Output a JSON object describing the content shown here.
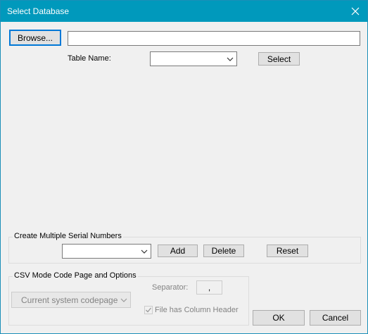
{
  "window": {
    "title": "Select Database"
  },
  "toolbar": {
    "browse_label": "Browse...",
    "path_value": "",
    "table_name_label": "Table Name:",
    "table_name_value": "",
    "select_label": "Select"
  },
  "serial_group": {
    "title": "Create Multiple Serial Numbers",
    "combo_value": "",
    "add_label": "Add",
    "delete_label": "Delete",
    "reset_label": "Reset"
  },
  "csv_group": {
    "title": "CSV Mode Code Page and Options",
    "codepage_value": "Current system codepage",
    "separator_label": "Separator:",
    "separator_value": ",",
    "header_checkbox_label": "File has Column Header",
    "header_checked": true
  },
  "footer": {
    "ok_label": "OK",
    "cancel_label": "Cancel"
  },
  "colors": {
    "titlebar": "#0099bc",
    "window_bg": "#f0f0f0",
    "focus_border": "#0078d7"
  },
  "icons": {
    "close": "close-icon",
    "dropdown": "chevron-down-icon",
    "check": "checkmark-icon"
  }
}
